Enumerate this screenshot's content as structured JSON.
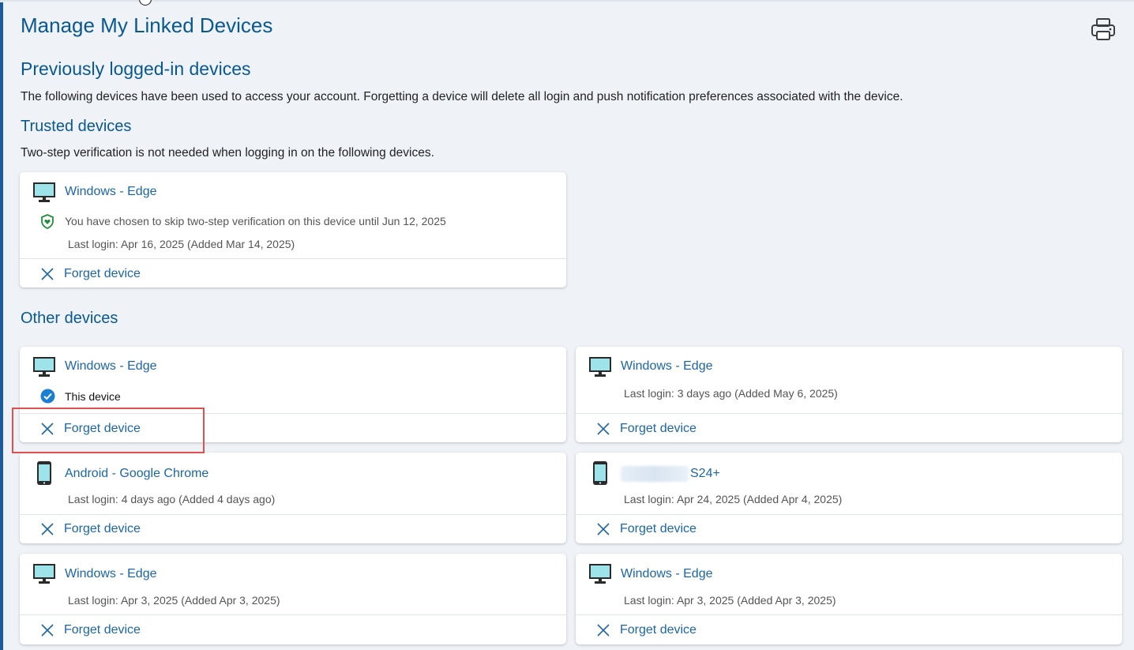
{
  "page": {
    "title": "Manage My Linked Devices",
    "print_icon": "printer-icon"
  },
  "previous": {
    "heading": "Previously logged-in devices",
    "description": "The following devices have been used to access your account. Forgetting a device will delete all login and push notification preferences associated with the device."
  },
  "trusted": {
    "heading": "Trusted devices",
    "description": "Two-step verification is not needed when logging in on the following devices.",
    "devices": [
      {
        "name": "Windows - Edge",
        "icon": "monitor-icon",
        "status": "You have chosen to skip two-step verification on this device until Jun 12, 2025",
        "last_login": "Last login: Apr 16, 2025 (Added Mar 14, 2025)",
        "forget_label": "Forget device"
      }
    ]
  },
  "other": {
    "heading": "Other devices",
    "devices": [
      {
        "name": "Windows - Edge",
        "icon": "monitor-icon",
        "status": "This device",
        "forget_label": "Forget device"
      },
      {
        "name": "Windows - Edge",
        "icon": "monitor-icon",
        "last_login": "Last login: 3 days ago (Added May 6, 2025)",
        "forget_label": "Forget device"
      },
      {
        "name": "Android - Google Chrome",
        "icon": "phone-icon",
        "last_login": "Last login: 4 days ago (Added 4 days ago)",
        "forget_label": "Forget device"
      },
      {
        "name": "S24+",
        "icon": "phone-icon",
        "last_login": "Last login: Apr 24, 2025 (Added Apr 4, 2025)",
        "forget_label": "Forget device"
      },
      {
        "name": "Windows - Edge",
        "icon": "monitor-icon",
        "last_login": "Last login: Apr 3, 2025 (Added Apr 3, 2025)",
        "forget_label": "Forget device"
      },
      {
        "name": "Windows - Edge",
        "icon": "monitor-icon",
        "last_login": "Last login: Apr 3, 2025 (Added Apr 3, 2025)",
        "forget_label": "Forget device"
      }
    ]
  },
  "colors": {
    "link": "#1b66a8",
    "heading": "#0a5891",
    "background": "#eff3f7",
    "highlight": "#e05050"
  }
}
